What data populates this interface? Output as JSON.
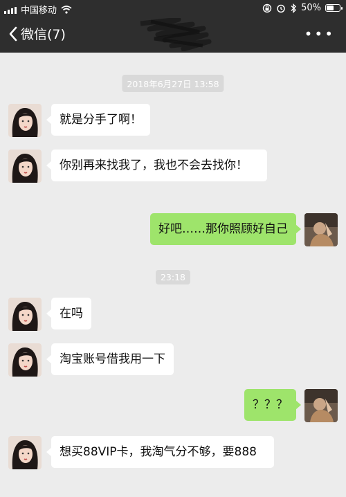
{
  "status_bar": {
    "carrier": "中国移动",
    "battery_text": "50%",
    "battery_level": 0.5,
    "icons": [
      "signal-icon",
      "wifi-icon",
      "lock-rotation-icon",
      "alarm-icon",
      "bluetooth-icon",
      "battery-icon"
    ]
  },
  "nav": {
    "back_label": "微信(7)",
    "more_label": "•••"
  },
  "timestamps": [
    "2018年6月27日 13:58",
    "23:18"
  ],
  "messages": [
    {
      "side": "in",
      "text": "就是分手了啊！"
    },
    {
      "side": "in",
      "text": "你别再来找我了，我也不会去找你！"
    },
    {
      "side": "out",
      "text": "好吧……那你照顾好自己"
    },
    {
      "side": "in",
      "text": "在吗"
    },
    {
      "side": "in",
      "text": "淘宝账号借我用一下"
    },
    {
      "side": "out",
      "text": "？？？"
    },
    {
      "side": "in",
      "text": "想买88VIP卡，我淘气分不够，要888"
    }
  ],
  "colors": {
    "chat_background": "#ececec",
    "nav_background": "#2e2e2e",
    "incoming_bubble": "#ffffff",
    "outgoing_bubble": "#9ee46b",
    "timestamp_background": "#d9d9d9"
  }
}
